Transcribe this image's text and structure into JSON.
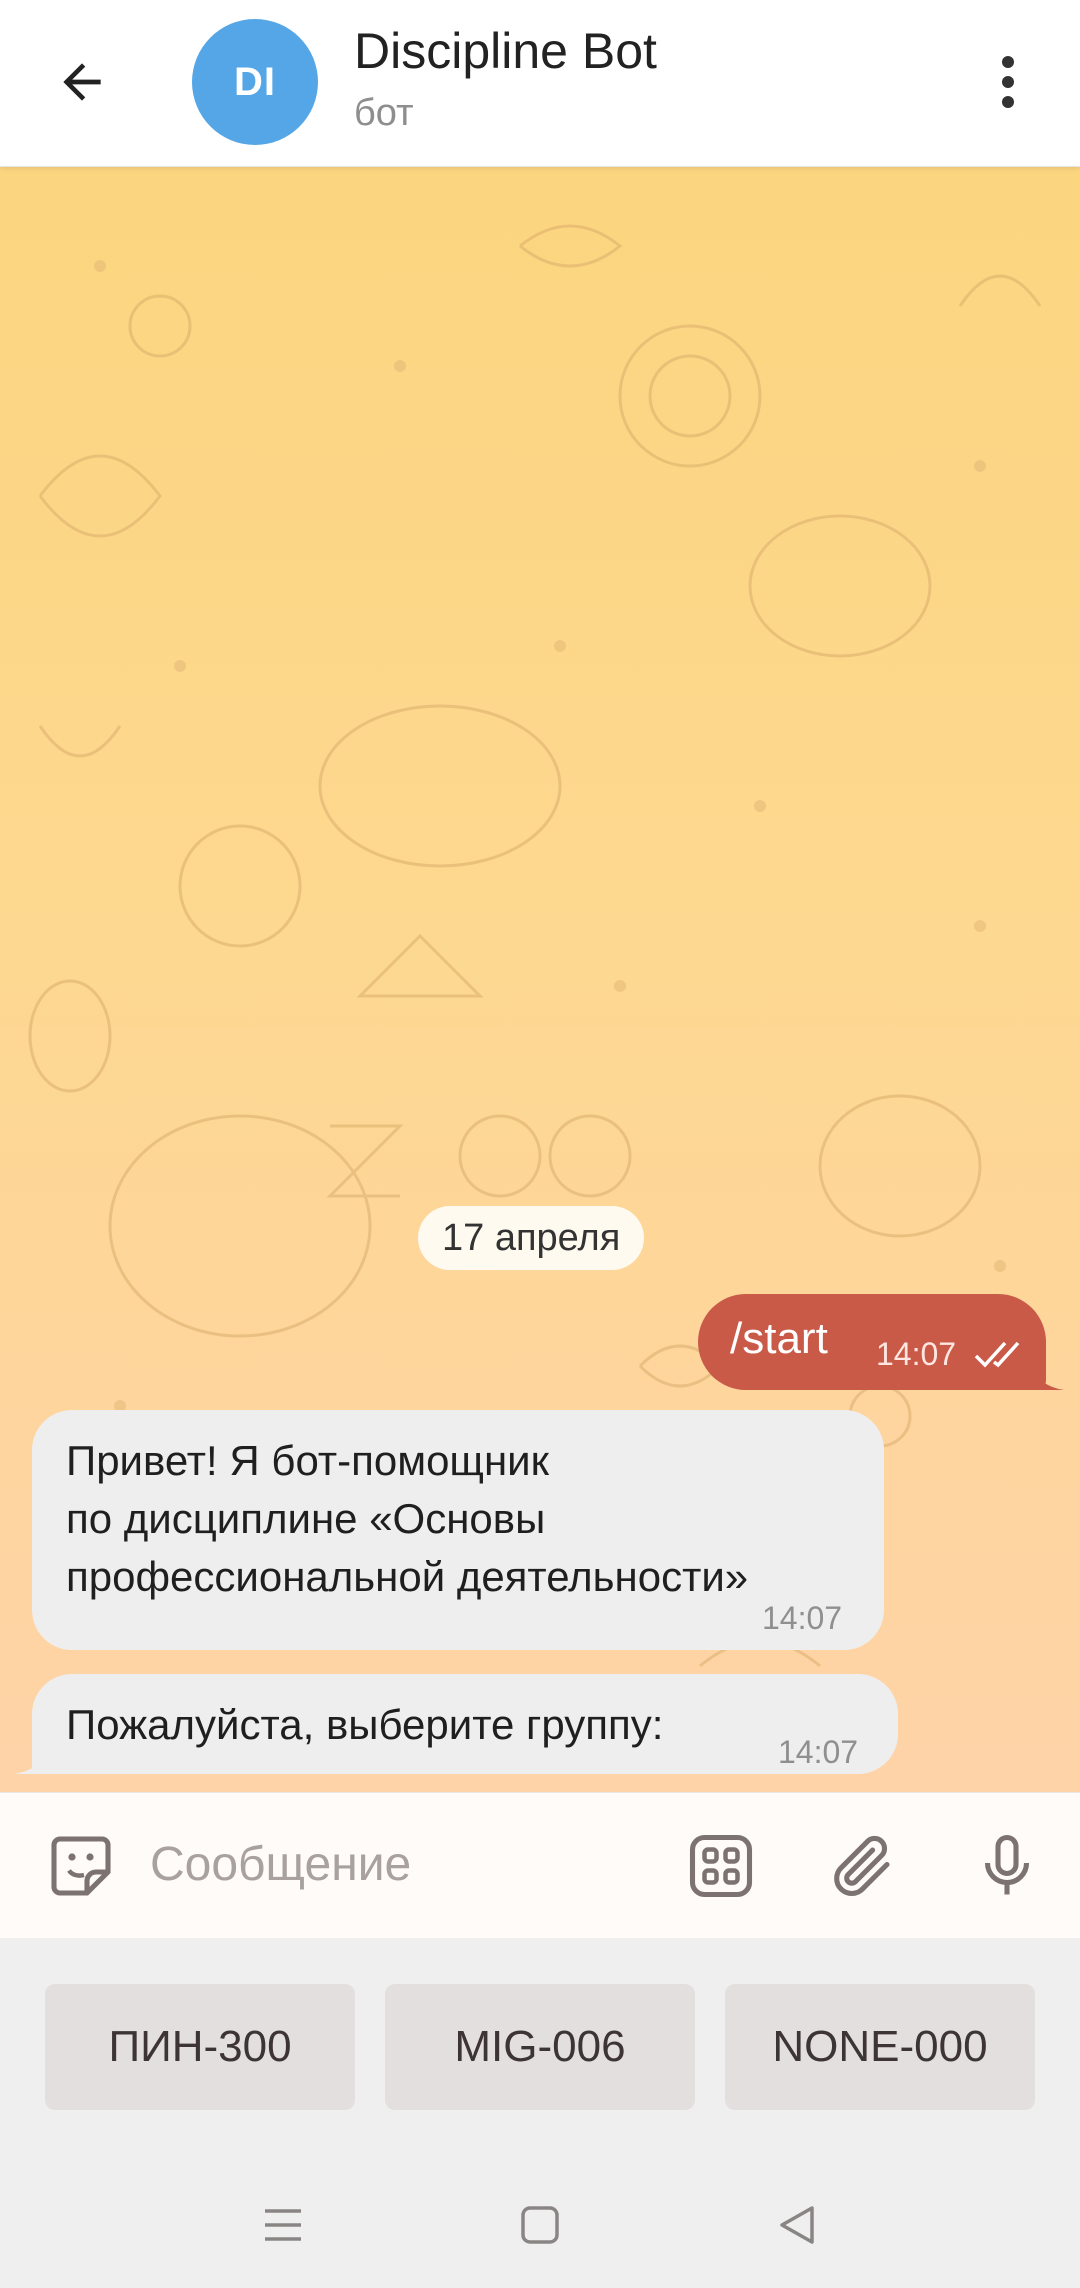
{
  "header": {
    "avatar_initials": "DI",
    "title": "Discipline Bot",
    "subtitle": "бот",
    "avatar_color": "#55a6e6"
  },
  "chat": {
    "date_label": "17 апреля",
    "messages": [
      {
        "direction": "out",
        "text": "/start",
        "time": "14:07",
        "status": "read"
      },
      {
        "direction": "in",
        "lines": [
          "Привет! Я бот-помощник",
          "по дисциплине «Основы",
          "профессиональной деятельности»"
        ],
        "time": "14:07"
      },
      {
        "direction": "in",
        "text": "Пожалуйста, выберите группу:",
        "time": "14:07"
      }
    ],
    "out_bubble_color": "#c95a48",
    "in_bubble_color": "#efeeef"
  },
  "input": {
    "placeholder": "Сообщение",
    "icons": [
      "sticker-icon",
      "bot-keyboard-icon",
      "attach-icon",
      "microphone-icon"
    ]
  },
  "keyboard": {
    "buttons": [
      "ПИН-300",
      "MIG-006",
      "NONE-000"
    ]
  },
  "navbar": {
    "icons": [
      "menu-lines-icon",
      "home-square-icon",
      "back-triangle-icon"
    ]
  }
}
